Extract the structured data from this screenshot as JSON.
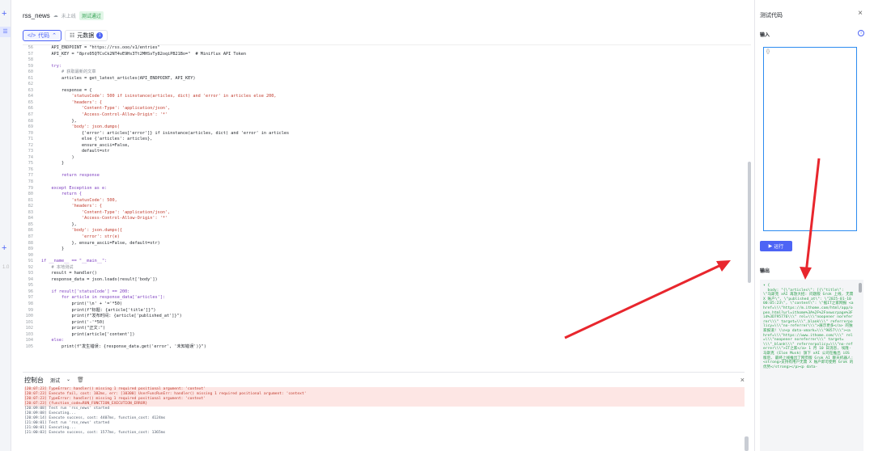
{
  "header": {
    "name": "rss_news",
    "status": "未上线",
    "badge": "测试通过"
  },
  "tabs": [
    {
      "label": "代码"
    },
    {
      "label": "元数据",
      "count": "1"
    }
  ],
  "code_lines": [
    {
      "n": "56",
      "t": "    API_ENDPOINT = \"https://rss.ooo/v1/entries\""
    },
    {
      "n": "57",
      "t": "    API_KEY = \"8prx05QTCsCk2NT4vE9Hs3Tt2MHSvTy82oqiPB21Bo=\"  # Miniflux API Token"
    },
    {
      "n": "58",
      "t": ""
    },
    {
      "n": "59",
      "t": "    try:"
    },
    {
      "n": "60",
      "t": "        # 获取最新的文章"
    },
    {
      "n": "61",
      "t": "        articles = get_latest_articles(API_ENDPOINT, API_KEY)"
    },
    {
      "n": "62",
      "t": ""
    },
    {
      "n": "63",
      "t": "        response = {"
    },
    {
      "n": "64",
      "t": "            'statusCode': 500 if isinstance(articles, dict) and 'error' in articles else 200,"
    },
    {
      "n": "65",
      "t": "            'headers': {"
    },
    {
      "n": "66",
      "t": "                'Content-Type': 'application/json',"
    },
    {
      "n": "67",
      "t": "                'Access-Control-Allow-Origin': '*'"
    },
    {
      "n": "68",
      "t": "            },"
    },
    {
      "n": "69",
      "t": "            'body': json.dumps("
    },
    {
      "n": "70",
      "t": "                {'error': articles['error']} if isinstance(articles, dict) and 'error' in articles"
    },
    {
      "n": "71",
      "t": "                else {'articles': articles},"
    },
    {
      "n": "72",
      "t": "                ensure_ascii=False,"
    },
    {
      "n": "73",
      "t": "                default=str"
    },
    {
      "n": "74",
      "t": "            )"
    },
    {
      "n": "75",
      "t": "        }"
    },
    {
      "n": "76",
      "t": ""
    },
    {
      "n": "77",
      "t": "        return response"
    },
    {
      "n": "78",
      "t": ""
    },
    {
      "n": "79",
      "t": "    except Exception as e:"
    },
    {
      "n": "80",
      "t": "        return {"
    },
    {
      "n": "81",
      "t": "            'statusCode': 500,"
    },
    {
      "n": "82",
      "t": "            'headers': {"
    },
    {
      "n": "83",
      "t": "                'Content-Type': 'application/json',"
    },
    {
      "n": "84",
      "t": "                'Access-Control-Allow-Origin': '*'"
    },
    {
      "n": "85",
      "t": "            },"
    },
    {
      "n": "86",
      "t": "            'body': json.dumps({"
    },
    {
      "n": "87",
      "t": "                'error': str(e)"
    },
    {
      "n": "88",
      "t": "            }, ensure_ascii=False, default=str)"
    },
    {
      "n": "89",
      "t": "        }"
    },
    {
      "n": "90",
      "t": ""
    },
    {
      "n": "91",
      "t": "if __name__ == \"__main__\":"
    },
    {
      "n": "92",
      "t": "    # 本地测试"
    },
    {
      "n": "93",
      "t": "    result = handler()"
    },
    {
      "n": "94",
      "t": "    response_data = json.loads(result['body'])"
    },
    {
      "n": "95",
      "t": ""
    },
    {
      "n": "96",
      "t": "    if result['statusCode'] == 200:"
    },
    {
      "n": "97",
      "t": "        for article in response_data['articles']:"
    },
    {
      "n": "98",
      "t": "            print('\\n' + '='*50)"
    },
    {
      "n": "99",
      "t": "            print(f\"标题: {article['title']}\")"
    },
    {
      "n": "100",
      "t": "            print(f\"发布时间: {article['published_at']}\")"
    },
    {
      "n": "101",
      "t": "            print('-'*50)"
    },
    {
      "n": "102",
      "t": "            print(\"正文:\")"
    },
    {
      "n": "103",
      "t": "            print(article['content'])"
    },
    {
      "n": "104",
      "t": "    else:"
    },
    {
      "n": "105",
      "t": "        print(f\"发生错误: {response_data.get('error', '未知错误')}\")"
    }
  ],
  "console": {
    "title": "控制台",
    "filter": "测试",
    "logs": [
      {
        "type": "err",
        "t": "[20:07:23] TypeError: handler() missing 1 required positional argument: 'context'"
      },
      {
        "type": "err",
        "t": "[20:07:23] Execute fail, cost: 102ms, err: [10300] UserFuncRunErr: handler() missing 1 required positional argument: 'context'"
      },
      {
        "type": "err",
        "t": "[20:07:23] TypeError: handler() missing 1 required positional argument: 'context'"
      },
      {
        "type": "err",
        "t": "[20:07:23] {function_code=RUN_FUNCTION_EXECUTION_ERROR}"
      },
      {
        "type": "ok",
        "t": "[20:09:08] Test run 'rss_news' started"
      },
      {
        "type": "ok",
        "t": "[20:09:08] Executing..."
      },
      {
        "type": "ok",
        "t": "[20:09:14] Execute success, cost: 4407ms, function_cost: 4124ms"
      },
      {
        "type": "ok",
        "t": "[21:00:01] Test run 'rss_news' started"
      },
      {
        "type": "ok",
        "t": "[21:00:01] Executing..."
      },
      {
        "type": "ok",
        "t": "[21:00:03] Execute success, cost: 1577ms, function_cost: 1365ms"
      }
    ]
  },
  "right_panel": {
    "title": "测试代码",
    "input_label": "输入",
    "input_value": "{}",
    "run_label": "运行",
    "output_label": "输出",
    "output_text": "▾ {\n  body: \"{\\\"articles\\\": [{\\\"title\\\": \\\"马斯克 xAI 再放大招: 问题版 Grok 上线, 无需 X 账户\\\", \\\"published_at\\\": \\\"2025-01-10 00:05:23\\\", \\\"content\\\": \\\"据IT之家网报 <a href=\\\\\\\"https://m.ithome.com/html/app/open.html?url=ithome%3A%2F%2Fnewsrpage%3Fid%3D795776\\\\\\\" rel=\\\\\\\"noopener noreferrer\\\\\\\" target=\\\\\\\"_blank\\\\\\\" referrerpolicy=\\\\\\\"no-referrer\\\\\\\">展示更多</a> 的独家报道! \\\\n<p data-vmark=\\\\\\\"9057\\\\\\\"><a href=\\\\\\\"https://www.ithome.com/\\\\\\\" rel=\\\\\\\"noopener noreferrer\\\\\\\" target=\\\\\\\"_blank\\\\\\\" referrerpolicy=\\\\\\\"no-referrer\\\\\\\">IT之家</a> 1 月 10 日消息, 埃隆·马斯克 (Elon Musk) 旗下 xAI 公司在推出 iOS 版后, 最终上线推出了网页版 Grok AI 聊天机器人: <strong>支持有用户无需 X 账户即可使用 Grok 的优势</strong></p><p data-"
  }
}
